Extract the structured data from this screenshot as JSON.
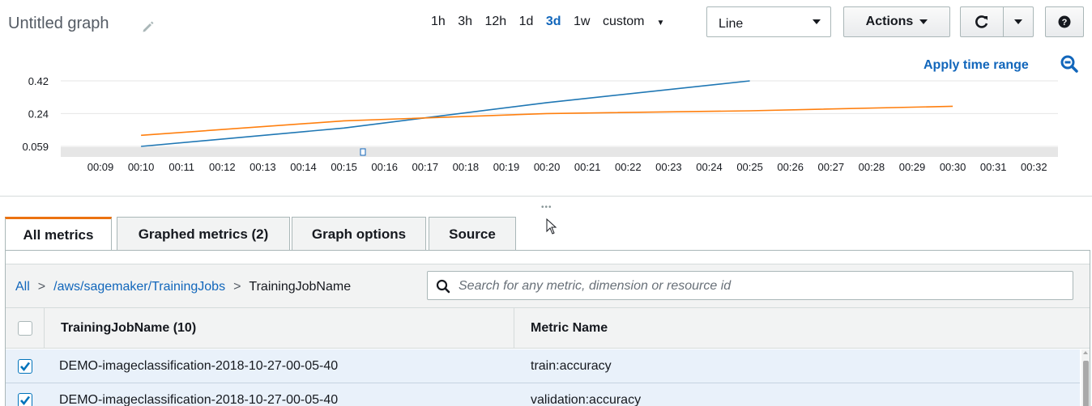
{
  "graph": {
    "title": "Untitled graph",
    "time_ranges": [
      "1h",
      "3h",
      "12h",
      "1d",
      "3d",
      "1w"
    ],
    "active_range": "3d",
    "custom_label": "custom",
    "view_type": "Line",
    "actions_label": "Actions",
    "apply_time_range_label": "Apply time range"
  },
  "chart_data": {
    "type": "line",
    "y_ticks": [
      "0.42",
      "0.24",
      "0.059"
    ],
    "x_ticks": [
      "00:09",
      "00:10",
      "00:11",
      "00:12",
      "00:13",
      "00:14",
      "00:15",
      "00:16",
      "00:17",
      "00:18",
      "00:19",
      "00:20",
      "00:21",
      "00:22",
      "00:23",
      "00:24",
      "00:25",
      "00:26",
      "00:27",
      "00:28",
      "00:29",
      "00:30",
      "00:31",
      "00:32"
    ],
    "ylim": [
      0.059,
      0.42
    ],
    "series": [
      {
        "color": "#1f77b4",
        "points": [
          [
            10,
            0.059
          ],
          [
            15,
            0.16
          ],
          [
            20,
            0.3
          ],
          [
            25,
            0.42
          ]
        ]
      },
      {
        "color": "#ff7f0e",
        "points": [
          [
            10,
            0.12
          ],
          [
            15,
            0.2
          ],
          [
            20,
            0.24
          ],
          [
            25,
            0.255
          ],
          [
            30,
            0.28
          ]
        ]
      }
    ],
    "grid": true
  },
  "tabs": [
    {
      "label": "All metrics",
      "active": true
    },
    {
      "label": "Graphed metrics (2)",
      "active": false
    },
    {
      "label": "Graph options",
      "active": false
    },
    {
      "label": "Source",
      "active": false
    }
  ],
  "breadcrumb": {
    "all": "All",
    "namespace": "/aws/sagemaker/TrainingJobs",
    "dimension": "TrainingJobName",
    "separator": ">"
  },
  "search": {
    "placeholder": "Search for any metric, dimension or resource id"
  },
  "table": {
    "columns": [
      "TrainingJobName (10)",
      "Metric Name"
    ],
    "rows": [
      {
        "job": "DEMO-imageclassification-2018-10-27-00-05-40",
        "metric": "train:accuracy",
        "checked": true
      },
      {
        "job": "DEMO-imageclassification-2018-10-27-00-05-40",
        "metric": "validation:accuracy",
        "checked": true
      }
    ]
  },
  "colors": {
    "accent": "#1166bb",
    "tab_active": "#ec7211",
    "row_selected": "#e9f1fa"
  }
}
